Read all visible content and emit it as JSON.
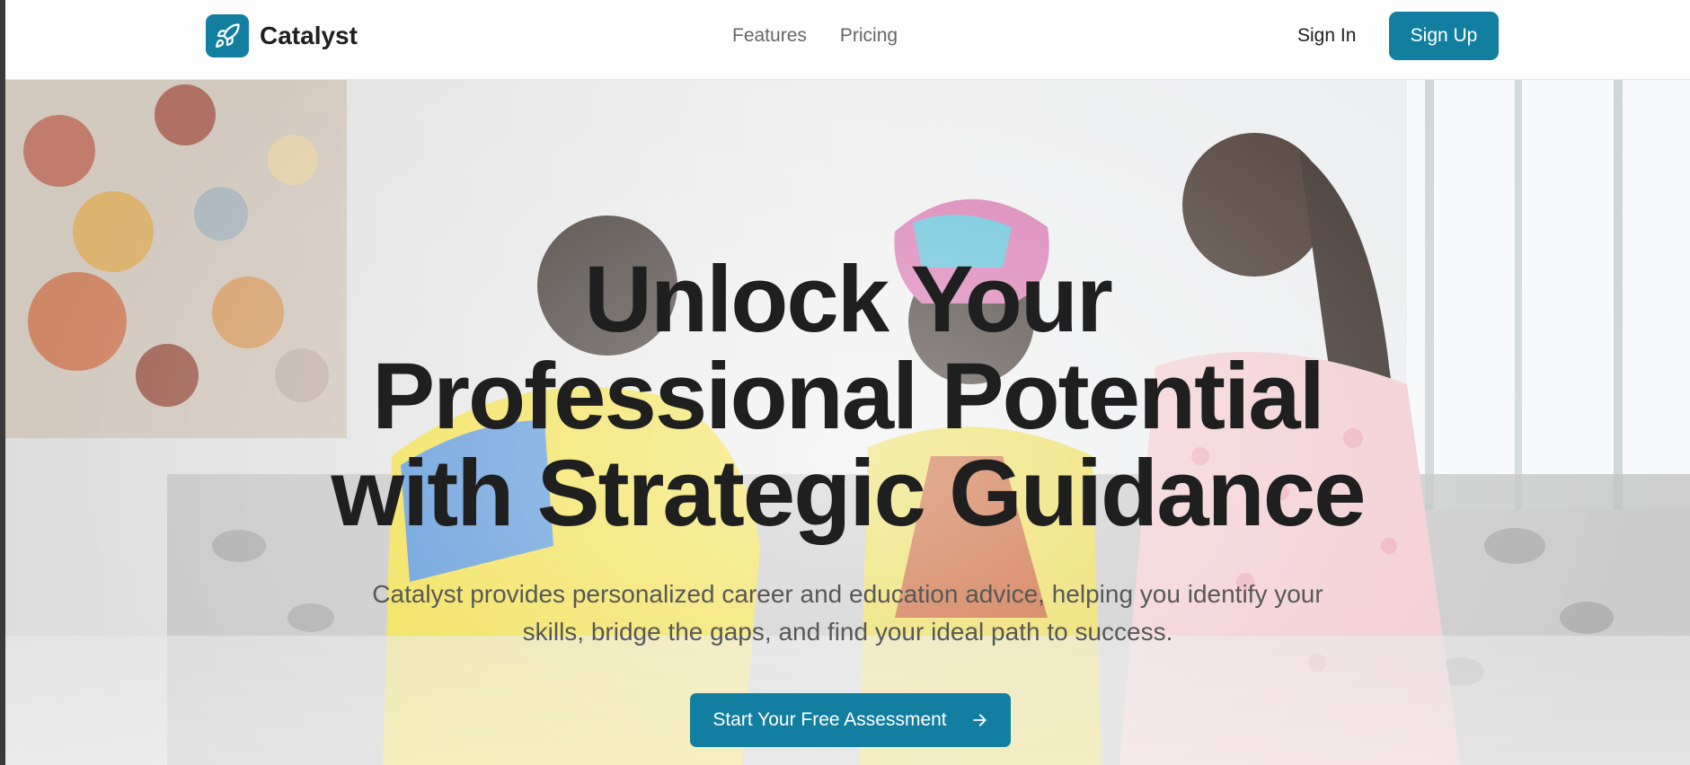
{
  "header": {
    "brand": "Catalyst",
    "nav": [
      {
        "label": "Features"
      },
      {
        "label": "Pricing"
      }
    ],
    "sign_in": "Sign In",
    "sign_up": "Sign Up"
  },
  "hero": {
    "title_lines": [
      "Unlock Your",
      "Professional Potential",
      "with Strategic Guidance"
    ],
    "subtitle_lines": [
      "Catalyst provides personalized career and education advice, helping you identify your",
      "skills, bridge the gaps, and find your ideal path to success."
    ],
    "cta_label": "Start Your Free Assessment",
    "cta_icon": "arrow-right-icon",
    "background_image": "three women talking on a sofa, abstract painting on wall"
  },
  "colors": {
    "accent": "#127fa0",
    "text_dark": "#1f1f1f",
    "text_muted": "#666666"
  }
}
